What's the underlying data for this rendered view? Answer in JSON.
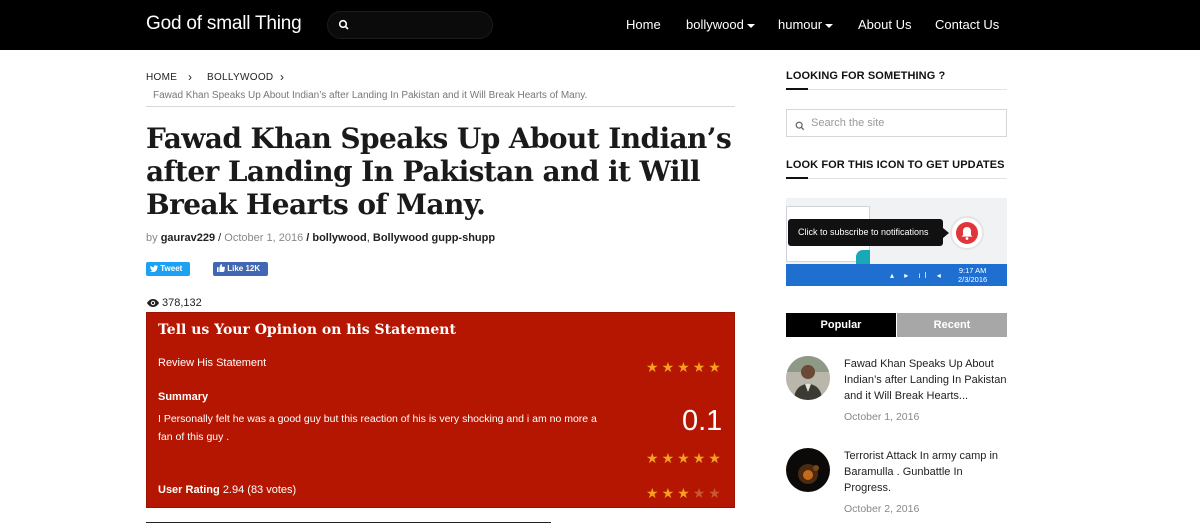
{
  "site": {
    "brand": "God of small Thing",
    "nav": [
      {
        "label": "Home",
        "dropdown": false
      },
      {
        "label": "bollywood",
        "dropdown": true
      },
      {
        "label": "humour",
        "dropdown": true
      },
      {
        "label": "About Us",
        "dropdown": false
      },
      {
        "label": "Contact Us",
        "dropdown": false
      }
    ]
  },
  "breadcrumb": {
    "items": [
      "HOME",
      "BOLLYWOOD"
    ],
    "separator": "›",
    "current": "Fawad Khan Speaks Up About Indian’s after Landing In Pakistan and it Will Break Hearts of Many."
  },
  "article": {
    "title": "Fawad Khan Speaks Up About Indian’s after Landing In Pakistan and it Will Break Hearts of Many.",
    "by": "by",
    "author": "gaurav229",
    "sep1": " / ",
    "date": "October 1, 2016",
    "sep2": " / ",
    "category1": "bollywood",
    "comma": ", ",
    "category2": "Bollywood gupp-shupp",
    "tweet_label": "Tweet",
    "like_label": "Like 12K",
    "views": "378,132"
  },
  "review": {
    "title": "Tell us Your Opinion on his Statement",
    "criterion_label": "Review His Statement",
    "criterion_stars": 5,
    "summary_heading": "Summary",
    "summary_text": "I Personally felt he was a good guy but this reaction of his is very shocking and i am no more a fan of this guy .",
    "score": "0.1",
    "score_stars": 5,
    "user_rating_label": "User Rating",
    "user_rating_value": "2.94 (83 votes)",
    "user_rating_stars": 3,
    "colors": {
      "box": "#b51602",
      "star_on": "#f5a11f",
      "star_off": "#c8582e"
    }
  },
  "sidebar": {
    "search_heading": "LOOKING FOR SOMETHING ?",
    "search_placeholder": "Search the site",
    "updates_heading": "LOOK FOR THIS ICON TO GET UPDATES",
    "notif_tooltip": "Click to subscribe to notifications",
    "notif_time": "9:17 AM",
    "notif_date": "2/3/2016",
    "tabs": [
      "Popular",
      "Recent"
    ],
    "active_tab": "Popular",
    "posts": [
      {
        "title": "Fawad Khan Speaks Up About Indian’s after Landing In Pakistan and it Will Break Hearts...",
        "date": "October 1, 2016"
      },
      {
        "title": "Terrorist Attack In army camp in Baramulla . Gunbattle In Progress.",
        "date": "October 2, 2016"
      }
    ]
  }
}
